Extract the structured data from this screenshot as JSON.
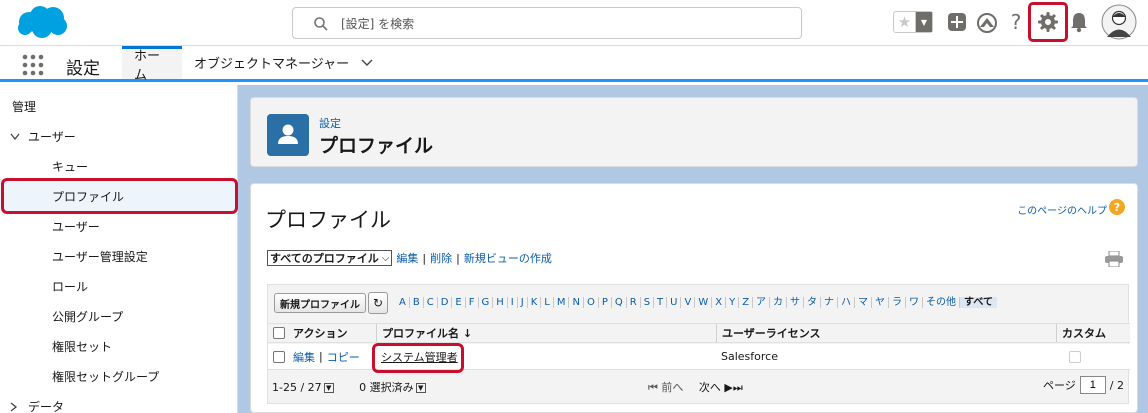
{
  "header": {
    "search_placeholder": "[設定] を検索",
    "icons": [
      "salesforce-logo",
      "search-icon",
      "star-icon",
      "plus-icon",
      "trailhead-icon",
      "help-icon",
      "gear-icon",
      "bell-icon",
      "avatar"
    ],
    "help_glyph": "?"
  },
  "appnav": {
    "app_name": "設定",
    "tabs": [
      {
        "label": "ホーム",
        "active": true
      },
      {
        "label": "オブジェクトマネージャー",
        "active": false
      }
    ]
  },
  "sidebar": {
    "section": "管理",
    "group": "ユーザー",
    "items": [
      "キュー",
      "プロファイル",
      "ユーザー",
      "ユーザー管理設定",
      "ロール",
      "公開グループ",
      "権限セット",
      "権限セットグループ"
    ],
    "selected": "プロファイル",
    "next_group": "データ"
  },
  "page_header": {
    "breadcrumb": "設定",
    "title": "プロファイル"
  },
  "card": {
    "title": "プロファイル",
    "help_link": "このページのヘルプ",
    "help_glyph": "?",
    "view_select": "すべてのプロファイル",
    "view_links": [
      "編集",
      "削除",
      "新規ビューの作成"
    ],
    "new_button": "新規プロファイル",
    "alpha_filter": [
      "A",
      "B",
      "C",
      "D",
      "E",
      "F",
      "G",
      "H",
      "I",
      "J",
      "K",
      "L",
      "M",
      "N",
      "O",
      "P",
      "Q",
      "R",
      "S",
      "T",
      "U",
      "V",
      "W",
      "X",
      "Y",
      "Z",
      "ア",
      "カ",
      "サ",
      "タ",
      "ナ",
      "ハ",
      "マ",
      "ヤ",
      "ラ",
      "ワ",
      "その他"
    ],
    "alpha_all": "すべて",
    "columns": [
      "アクション",
      "プロファイル名 ↓",
      "ユーザーライセンス",
      "カスタム"
    ],
    "rows": [
      {
        "action_edit": "編集",
        "action_copy": "コピー",
        "name": "システム管理者",
        "license": "Salesforce",
        "custom": false
      }
    ],
    "pager": {
      "range": "1-25 / 27",
      "selected": "0 選択済み",
      "prev": "前へ",
      "next": "次へ",
      "page_label": "ページ",
      "page": "1",
      "total": "/ 2"
    }
  },
  "colors": {
    "brand_blue": "#0176d3",
    "link": "#0b5cab",
    "highlight_red": "#c8102e",
    "main_bg": "#b0c8e4"
  }
}
